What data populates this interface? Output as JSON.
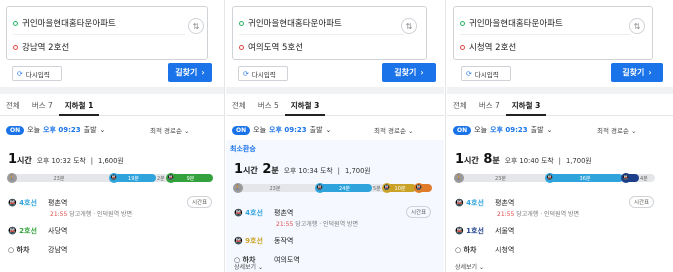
{
  "panels": [
    {
      "origin": "귀인마을현대홈타운아파트",
      "destination": "강남역 2호선",
      "reinput_label": "다시입력",
      "search_label": "길찾기",
      "tabs": [
        "전체",
        "버스 7",
        "지하철 1"
      ],
      "active_tab": 2,
      "on_label": "ON",
      "depart_prefix": "오늘",
      "depart_time": "오후 09:23",
      "depart_suffix": "출발",
      "sort_label": "최적 경로순",
      "min_transfer_label": "",
      "duration_h": "1",
      "duration_h_unit": "시간",
      "duration_m": "",
      "duration_m_unit": "",
      "arrival": "오후 10:32 도착",
      "fare": "1,600원",
      "bar": [
        {
          "type": "walk",
          "label": "23분"
        },
        {
          "type": "sub",
          "line": "4",
          "label": "19분",
          "color": "#2fa3dc"
        },
        {
          "type": "gap",
          "label": "2분"
        },
        {
          "type": "sub",
          "line": "2",
          "label": "9분",
          "color": "#33a23d"
        }
      ],
      "steps": [
        {
          "line": "4호선",
          "line_color": "#2fa3dc",
          "station": "평촌역",
          "dep_time": "21:55",
          "dep_desc": "당고개행 · 인덕원역 방면",
          "timetable": "시간표"
        },
        {
          "line": "2호선",
          "line_color": "#33a23d",
          "station": "사당역"
        },
        {
          "line": "하차",
          "line_color": "#333333",
          "station": "강남역"
        }
      ],
      "detail_label": ""
    },
    {
      "origin": "귀인마을현대홈타운아파트",
      "destination": "여의도역 5호선",
      "reinput_label": "다시입력",
      "search_label": "길찾기",
      "tabs": [
        "전체",
        "버스 5",
        "지하철 3"
      ],
      "active_tab": 2,
      "on_label": "ON",
      "depart_prefix": "오늘",
      "depart_time": "오후 09:23",
      "depart_suffix": "출발",
      "sort_label": "최적 경로순",
      "min_transfer_label": "최소환승",
      "duration_h": "1",
      "duration_h_unit": "시간",
      "duration_m": "2",
      "duration_m_unit": "분",
      "arrival": "오후 10:34 도착",
      "fare": "1,700원",
      "bar": [
        {
          "type": "walk",
          "label": "23분"
        },
        {
          "type": "sub",
          "line": "4",
          "label": "24분",
          "color": "#2fa3dc"
        },
        {
          "type": "gap",
          "label": "5분"
        },
        {
          "type": "sub",
          "line": "9",
          "label": "10분",
          "color": "#c9a227"
        },
        {
          "type": "sub",
          "line": "",
          "label": "",
          "color": "#e07b2a"
        }
      ],
      "steps": [
        {
          "line": "4호선",
          "line_color": "#2fa3dc",
          "station": "평촌역",
          "dep_time": "21:55",
          "dep_desc": "당고개행 · 인덕원역 방면",
          "timetable": "시간표"
        },
        {
          "line": "9호선",
          "line_color": "#c9a227",
          "station": "동작역"
        },
        {
          "line": "하차",
          "line_color": "#333333",
          "station": "여의도역"
        }
      ],
      "detail_label": "상세보기"
    },
    {
      "origin": "귀인마을현대홈타운아파트",
      "destination": "시청역 2호선",
      "reinput_label": "다시입력",
      "search_label": "길찾기",
      "tabs": [
        "전체",
        "버스 7",
        "지하철 3"
      ],
      "active_tab": 2,
      "on_label": "ON",
      "depart_prefix": "오늘",
      "depart_time": "오후 09:23",
      "depart_suffix": "출발",
      "sort_label": "최적 경로순",
      "min_transfer_label": "",
      "duration_h": "1",
      "duration_h_unit": "시간",
      "duration_m": "8",
      "duration_m_unit": "분",
      "arrival": "오후 10:40 도착",
      "fare": "1,700원",
      "bar": [
        {
          "type": "walk",
          "label": "23분"
        },
        {
          "type": "sub",
          "line": "4",
          "label": "36분",
          "color": "#2fa3dc"
        },
        {
          "type": "sub",
          "line": "1",
          "label": "",
          "color": "#1d3f8a"
        },
        {
          "type": "gap",
          "label": "4분"
        }
      ],
      "steps": [
        {
          "line": "4호선",
          "line_color": "#2fa3dc",
          "station": "평촌역",
          "dep_time": "21:55",
          "dep_desc": "당고개행 · 인덕원역 방면",
          "timetable": "시간표"
        },
        {
          "line": "1호선",
          "line_color": "#1d3f8a",
          "station": "서울역"
        },
        {
          "line": "하차",
          "line_color": "#333333",
          "station": "시청역"
        }
      ],
      "detail_label": "상세보기"
    }
  ],
  "icons": {
    "swap": "swap-vertical-icon",
    "refresh": "refresh-icon",
    "arrow": "arrow-right-icon",
    "walk": "walk-icon",
    "subway": "subway-icon",
    "chevron": "chevron-down-icon"
  }
}
